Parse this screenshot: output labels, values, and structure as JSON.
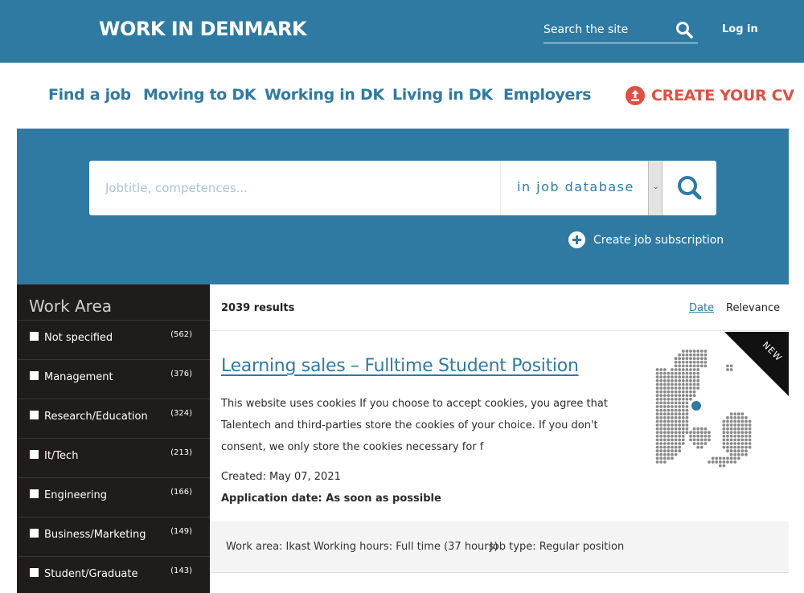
{
  "header": {
    "logo_text": "WORK IN DENMARK",
    "search_placeholder": "Search the site",
    "login_label": "Log in"
  },
  "nav": {
    "items": [
      {
        "label": "Find a job"
      },
      {
        "label": "Moving to DK"
      },
      {
        "label": "Working in DK"
      },
      {
        "label": "Living in DK"
      },
      {
        "label": "Employers"
      }
    ],
    "cta_label": "CREATE YOUR CV"
  },
  "search": {
    "placeholder": "Jobtitle, competences...",
    "database_label": "in job database",
    "subscription_label": "Create job subscription"
  },
  "sidebar": {
    "title": "Work Area",
    "filters": [
      {
        "label": "Not specified",
        "count": "(562)"
      },
      {
        "label": "Management",
        "count": "(376)"
      },
      {
        "label": "Research/Education",
        "count": "(324)"
      },
      {
        "label": "It/Tech",
        "count": "(213)"
      },
      {
        "label": "Engineering",
        "count": "(166)"
      },
      {
        "label": "Business/Marketing",
        "count": "(149)"
      },
      {
        "label": "Student/Graduate",
        "count": "(143)"
      }
    ]
  },
  "results": {
    "count_label": "2039 results",
    "sort_date": "Date",
    "sort_relevance": "Relevance"
  },
  "job": {
    "badge": "NEW",
    "title": "Learning sales – Fulltime Student Position",
    "description": "This website uses cookies If you choose to accept cookies, you agree that Talentech and third-parties store the cookies of your choice. If you don't consent, we only store the cookies necessary for f",
    "created": "Created: May 07, 2021",
    "application_date": "Application date: As soon as possible",
    "work_area": "Work area: Ikast",
    "working_hours": "Working hours: Full time (37 hours)",
    "job_type": "Job type: Regular position"
  },
  "colors": {
    "brand_blue": "#2e7aa3",
    "cta_red": "#e05040",
    "sidebar_dark": "#1f1c1a"
  }
}
